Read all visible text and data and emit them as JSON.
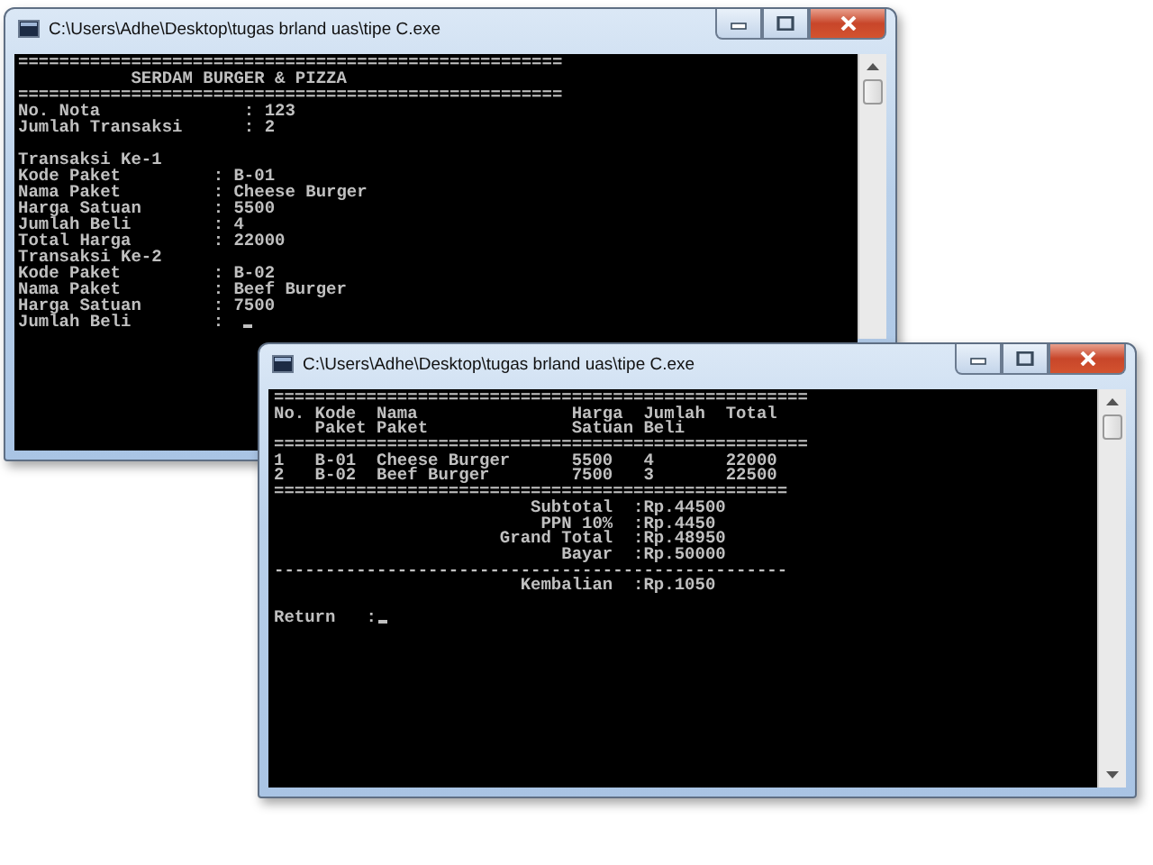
{
  "windows": [
    {
      "title": "C:\\Users\\Adhe\\Desktop\\tugas brland uas\\tipe C.exe",
      "cursor": true,
      "blocks": [
        [
          "=====================================================",
          "           SERDAM BURGER & PIZZA",
          "=====================================================",
          "No. Nota              : 123",
          "Jumlah Transaksi      : 2"
        ],
        [
          "Transaksi Ke-1",
          "Kode Paket         : B-01",
          "Nama Paket         : Cheese Burger",
          "Harga Satuan       : 5500",
          "Jumlah Beli        : 4",
          "Total Harga        : 22000",
          "Transaksi Ke-2",
          "Kode Paket         : B-02",
          "Nama Paket         : Beef Burger",
          "Harga Satuan       : 7500",
          "Jumlah Beli        : "
        ]
      ]
    },
    {
      "title": "C:\\Users\\Adhe\\Desktop\\tugas brland uas\\tipe C.exe",
      "cursor": true,
      "blocks": [
        [
          "====================================================",
          "No. Kode  Nama               Harga  Jumlah  Total",
          "    Paket Paket              Satuan Beli",
          "====================================================",
          "1   B-01  Cheese Burger      5500   4       22000",
          "2   B-02  Beef Burger        7500   3       22500",
          "==================================================",
          "                         Subtotal  :Rp.44500",
          "                          PPN 10%  :Rp.4450",
          "                      Grand Total  :Rp.48950",
          "                            Bayar  :Rp.50000",
          "--------------------------------------------------",
          "                        Kembalian  :Rp.1050"
        ],
        [
          "Return   :"
        ]
      ]
    }
  ]
}
